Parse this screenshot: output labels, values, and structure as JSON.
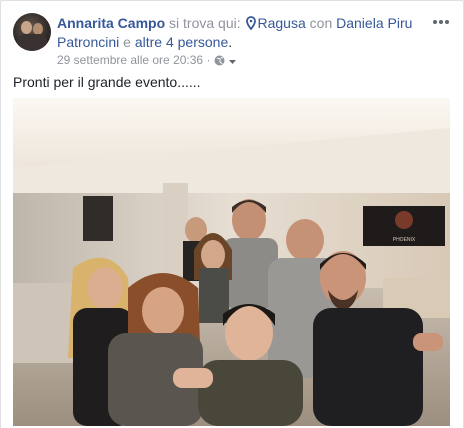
{
  "post": {
    "author": "Annarita Campo",
    "checkin_text": "si trova qui:",
    "location": "Ragusa",
    "with_text": "con",
    "tagged_person": "Daniela Piru Patroncini",
    "conjunction": "e",
    "others": "altre 4 persone",
    "period": ".",
    "timestamp": "29 settembre alle ore 20:36",
    "separator": "·",
    "text": "Pronti per il grande evento......",
    "icons": {
      "avatar": "profile-photo",
      "location": "map-pin-icon",
      "privacy": "globe-icon",
      "privacy_menu": "chevron-down-icon",
      "options": "more-options-icon"
    },
    "photo": {
      "description_sign": "banner-on-wall",
      "banner_text": "PHOENIX"
    }
  },
  "colors": {
    "link": "#365899",
    "text": "#1d2129",
    "muted": "#90949c",
    "background": "#e9ebee"
  }
}
